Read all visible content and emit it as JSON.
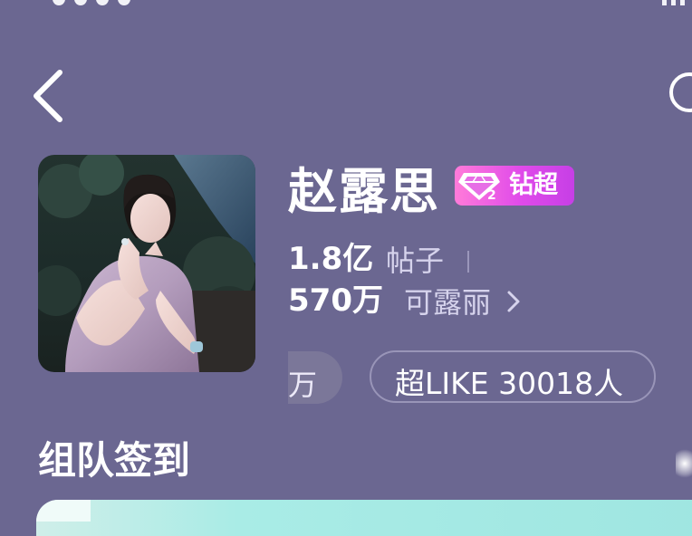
{
  "header": {
    "title": "赵露思",
    "badge_text": "钻超"
  },
  "stats": {
    "posts_value": "1.8亿",
    "posts_label": "帖子",
    "fans_value": "570万",
    "fans_label": "可露丽"
  },
  "pills": {
    "left_partial": "万",
    "like_text": "超LIKE 30018人"
  },
  "section": {
    "title": "组队签到"
  },
  "icons": {
    "back": "chevron-left-icon",
    "right": "circle-icon",
    "badge_gem": "diamond-icon",
    "fans_chevron": "chevron-right-icon"
  },
  "colors": {
    "background": "#6b6791",
    "badge_gradient_start": "#ff7bd9",
    "badge_gradient_end": "#c63fe6",
    "card_accent": "#a9ece6"
  }
}
